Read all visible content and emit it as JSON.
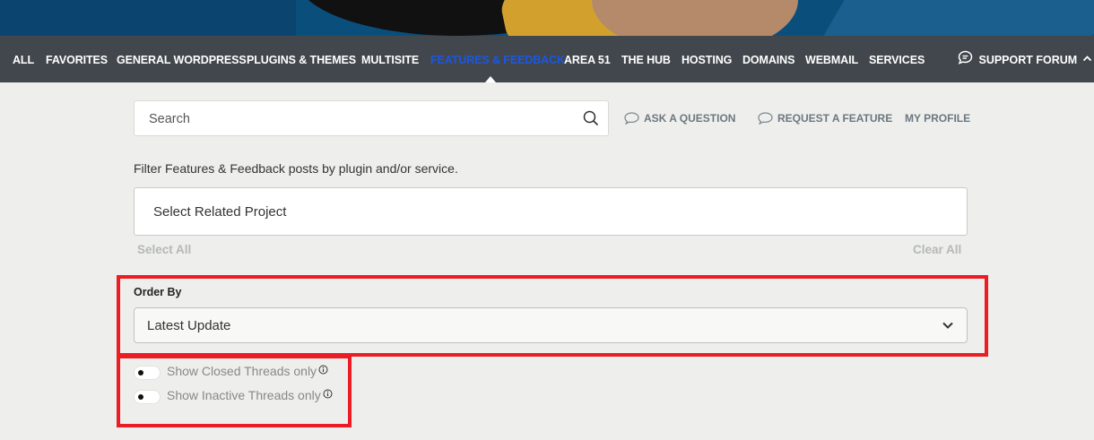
{
  "nav": {
    "items": [
      {
        "label": "ALL",
        "active": false
      },
      {
        "label": "FAVORITES",
        "active": false
      },
      {
        "label": "GENERAL WORDPRESS",
        "active": false
      },
      {
        "label": "PLUGINS & THEMES",
        "active": false
      },
      {
        "label": "MULTISITE",
        "active": false
      },
      {
        "label": "FEATURES & FEEDBACK",
        "active": true
      },
      {
        "label": "AREA 51",
        "active": false
      },
      {
        "label": "THE HUB",
        "active": false
      },
      {
        "label": "HOSTING",
        "active": false
      },
      {
        "label": "DOMAINS",
        "active": false
      },
      {
        "label": "WEBMAIL",
        "active": false
      },
      {
        "label": "SERVICES",
        "active": false
      }
    ],
    "support_label": "SUPPORT FORUM",
    "active_color": "#1a57e8"
  },
  "search": {
    "placeholder": "Search",
    "value": ""
  },
  "links": {
    "ask": "ASK A QUESTION",
    "request": "REQUEST A FEATURE",
    "profile": "MY PROFILE"
  },
  "filter": {
    "description": "Filter Features & Feedback posts by plugin and/or service.",
    "project_placeholder": "Select Related Project",
    "select_all": "Select All",
    "clear_all": "Clear All"
  },
  "order": {
    "label": "Order By",
    "selected": "Latest Update"
  },
  "toggles": {
    "closed": {
      "label": "Show Closed Threads only",
      "on": false
    },
    "inactive": {
      "label": "Show Inactive Threads only",
      "on": false
    }
  },
  "highlight_color": "#ec1c24"
}
